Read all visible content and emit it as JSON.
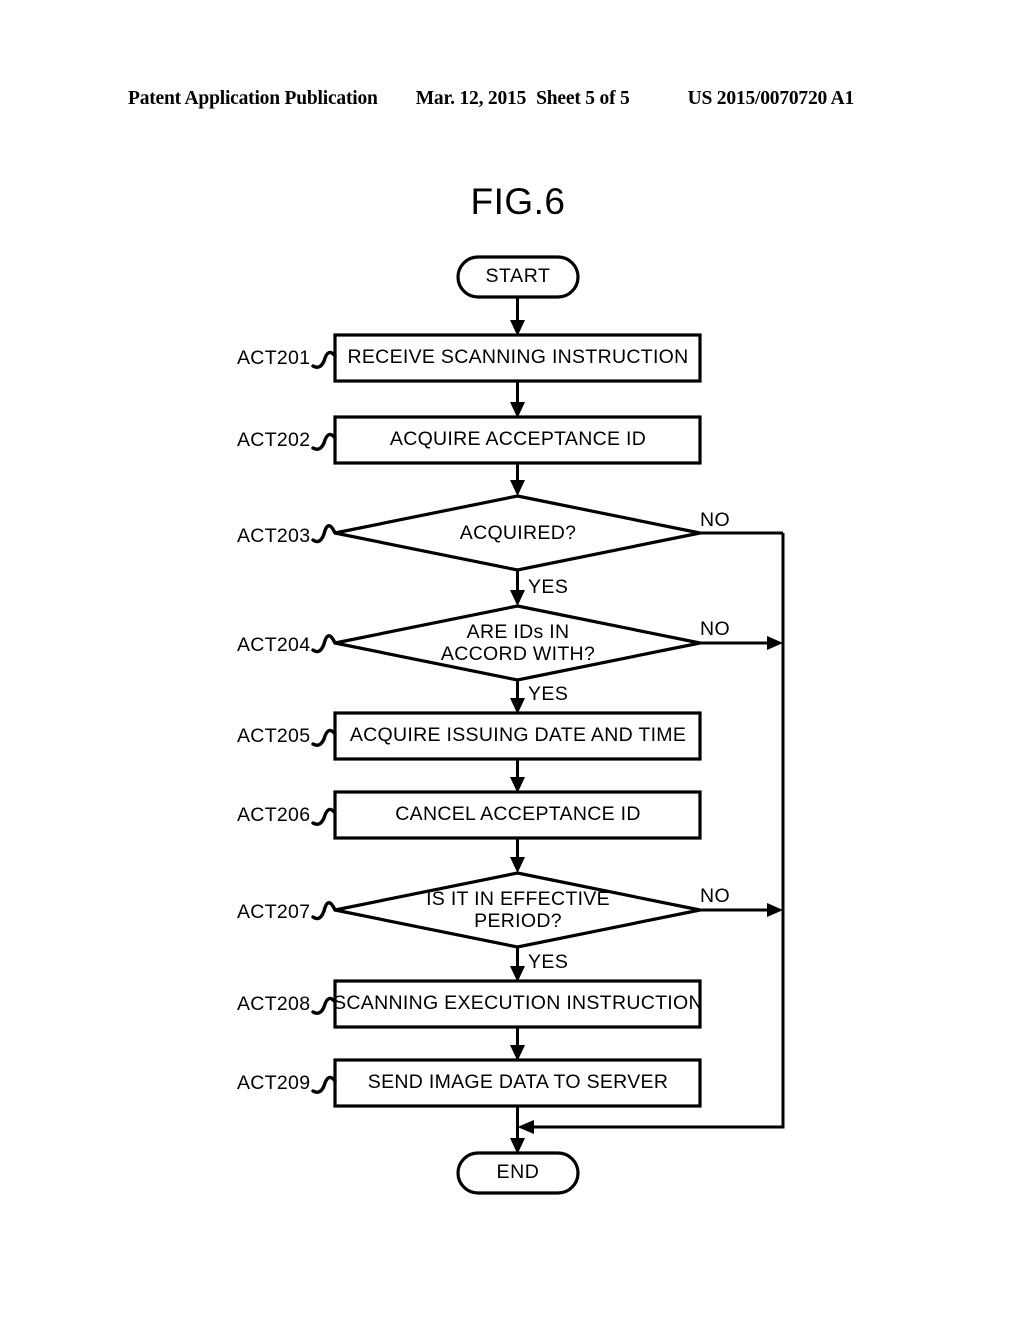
{
  "header": {
    "publication": "Patent Application Publication",
    "date": "Mar. 12, 2015",
    "sheet": "Sheet 5 of 5",
    "patent_number": "US 2015/0070720 A1"
  },
  "figure": {
    "title": "FIG.6"
  },
  "chart_data": {
    "type": "diagram",
    "diagram_type": "flowchart",
    "title": "FIG.6",
    "nodes": [
      {
        "id": "start",
        "shape": "terminator",
        "label": "START",
        "act": ""
      },
      {
        "id": "act201",
        "shape": "process",
        "label": "RECEIVE SCANNING INSTRUCTION",
        "act": "ACT201"
      },
      {
        "id": "act202",
        "shape": "process",
        "label": "ACQUIRE ACCEPTANCE ID",
        "act": "ACT202"
      },
      {
        "id": "act203",
        "shape": "decision",
        "label": "ACQUIRED?",
        "act": "ACT203"
      },
      {
        "id": "act204",
        "shape": "decision",
        "label": "ARE IDs IN ACCORD WITH?",
        "act": "ACT204"
      },
      {
        "id": "act205",
        "shape": "process",
        "label": "ACQUIRE ISSUING DATE AND TIME",
        "act": "ACT205"
      },
      {
        "id": "act206",
        "shape": "process",
        "label": "CANCEL ACCEPTANCE ID",
        "act": "ACT206"
      },
      {
        "id": "act207",
        "shape": "decision",
        "label": "IS IT IN EFFECTIVE PERIOD?",
        "act": "ACT207"
      },
      {
        "id": "act208",
        "shape": "process",
        "label": "SCANNING EXECUTION INSTRUCTION",
        "act": "ACT208"
      },
      {
        "id": "act209",
        "shape": "process",
        "label": "SEND IMAGE DATA TO SERVER",
        "act": "ACT209"
      },
      {
        "id": "end",
        "shape": "terminator",
        "label": "END",
        "act": ""
      }
    ],
    "edges": [
      {
        "from": "start",
        "to": "act201",
        "label": ""
      },
      {
        "from": "act201",
        "to": "act202",
        "label": ""
      },
      {
        "from": "act202",
        "to": "act203",
        "label": ""
      },
      {
        "from": "act203",
        "to": "act204",
        "label": "YES"
      },
      {
        "from": "act203",
        "to": "end",
        "label": "NO"
      },
      {
        "from": "act204",
        "to": "act205",
        "label": "YES"
      },
      {
        "from": "act204",
        "to": "end",
        "label": "NO"
      },
      {
        "from": "act205",
        "to": "act206",
        "label": ""
      },
      {
        "from": "act206",
        "to": "act207",
        "label": ""
      },
      {
        "from": "act207",
        "to": "act208",
        "label": "YES"
      },
      {
        "from": "act207",
        "to": "end",
        "label": "NO"
      },
      {
        "from": "act208",
        "to": "act209",
        "label": ""
      },
      {
        "from": "act209",
        "to": "end",
        "label": ""
      }
    ]
  },
  "nodes": {
    "start": {
      "label": "START"
    },
    "act201": {
      "act": "ACT201",
      "line1": "RECEIVE SCANNING INSTRUCTION"
    },
    "act202": {
      "act": "ACT202",
      "line1": "ACQUIRE ACCEPTANCE ID"
    },
    "act203": {
      "act": "ACT203",
      "line1": "ACQUIRED?"
    },
    "act204": {
      "act": "ACT204",
      "line1": "ARE IDs IN",
      "line2": "ACCORD WITH?"
    },
    "act205": {
      "act": "ACT205",
      "line1": "ACQUIRE ISSUING DATE AND TIME"
    },
    "act206": {
      "act": "ACT206",
      "line1": "CANCEL ACCEPTANCE ID"
    },
    "act207": {
      "act": "ACT207",
      "line1": "IS IT IN EFFECTIVE",
      "line2": "PERIOD?"
    },
    "act208": {
      "act": "ACT208",
      "line1": "SCANNING EXECUTION INSTRUCTION"
    },
    "act209": {
      "act": "ACT209",
      "line1": "SEND IMAGE DATA TO SERVER"
    },
    "end": {
      "label": "END"
    }
  },
  "branches": {
    "yes203": "YES",
    "no203": "NO",
    "yes204": "YES",
    "no204": "NO",
    "yes207": "YES",
    "no207": "NO"
  },
  "colors": {
    "ink": "#000000",
    "paper": "#ffffff"
  }
}
